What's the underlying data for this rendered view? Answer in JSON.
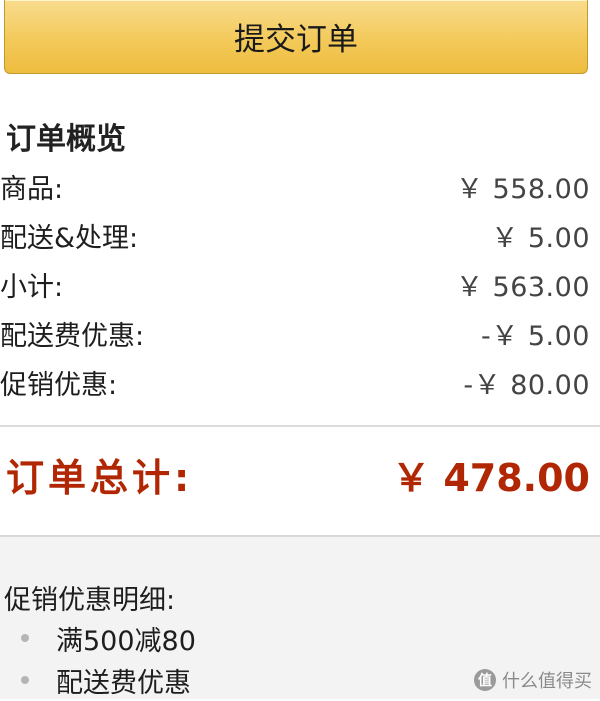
{
  "submit_button": {
    "label": "提交订单"
  },
  "summary": {
    "title": "订单概览",
    "rows": [
      {
        "label": "商品:",
        "value": "￥ 558.00"
      },
      {
        "label": "配送&处理:",
        "value": "￥ 5.00"
      },
      {
        "label": "小计:",
        "value": "￥ 563.00"
      },
      {
        "label": "配送费优惠:",
        "value": "-￥ 5.00"
      },
      {
        "label": "促销优惠:",
        "value": "-￥ 80.00"
      }
    ],
    "total": {
      "label": "订单总计:",
      "value": "￥ 478.00"
    }
  },
  "promo_details": {
    "title": "促销优惠明细:",
    "items": [
      "满500减80",
      "配送费优惠"
    ]
  },
  "watermark": {
    "text": "什么值得买",
    "icon": "smzdm-logo-icon"
  },
  "colors": {
    "button_gold": "#f3c95a",
    "total_red": "#b12704",
    "panel_gray": "#f3f3f3"
  }
}
